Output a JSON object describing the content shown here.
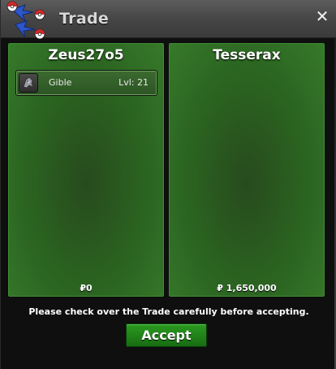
{
  "window": {
    "title": "Trade",
    "close_label": "✕"
  },
  "left_panel": {
    "player_name": "Zeus27o5",
    "items": [
      {
        "name": "Gible",
        "level": "Lvl: 21",
        "icon": "gible-icon"
      }
    ],
    "money": "₽0"
  },
  "right_panel": {
    "player_name": "Tesserax",
    "items": [],
    "money": "₽ 1,650,000"
  },
  "footer": {
    "instructions": "Please check over the Trade carefully before accepting.",
    "accept_label": "Accept"
  },
  "colors": {
    "panel_green": "#2b6421",
    "button_green": "#1f7f17",
    "titlebar": "#4a4a4a"
  }
}
